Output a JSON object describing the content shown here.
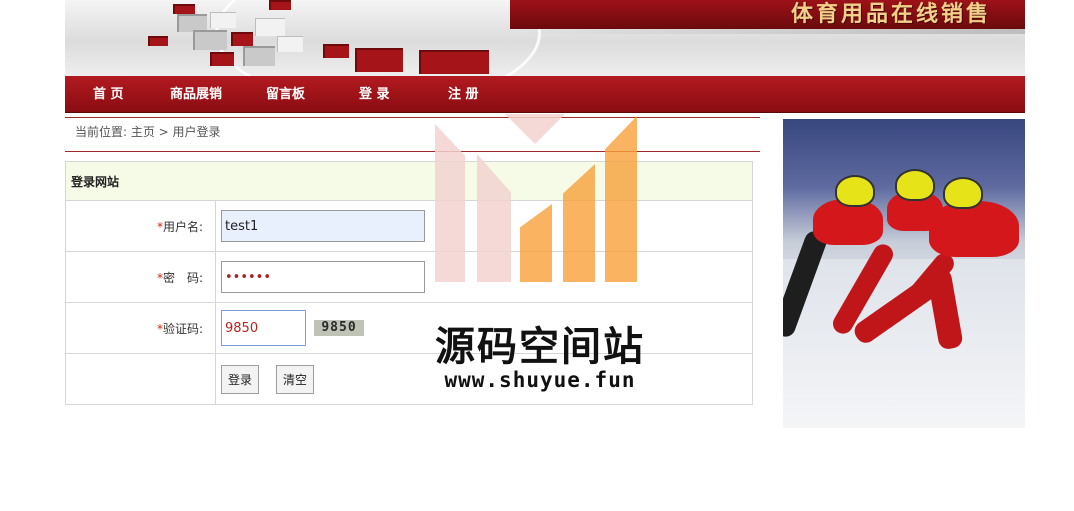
{
  "header": {
    "site_title": "体育用品在线销售"
  },
  "nav": {
    "items": [
      {
        "label": "首 页"
      },
      {
        "label": "商品展销"
      },
      {
        "label": "留言板"
      },
      {
        "label": "登 录"
      },
      {
        "label": "注 册"
      }
    ]
  },
  "breadcrumb": {
    "text": "当前位置: 主页 > 用户登录"
  },
  "login_form": {
    "title": "登录网站",
    "required_mark": "*",
    "username_label": "用户名:",
    "username_value": "test1",
    "password_label": "密　码:",
    "password_value": "••••••",
    "captcha_label": "验证码:",
    "captcha_value": "9850",
    "captcha_image_text": "9850",
    "submit_label": "登录",
    "clear_label": "清空"
  },
  "watermark": {
    "name": "源码空间站",
    "url": "www.shuyue.fun"
  },
  "colors": {
    "brand_red": "#9d1218",
    "title_gold": "#f1d08a",
    "form_header_bg": "#f6fbe7",
    "watermark_orange": "#f7a03a"
  }
}
